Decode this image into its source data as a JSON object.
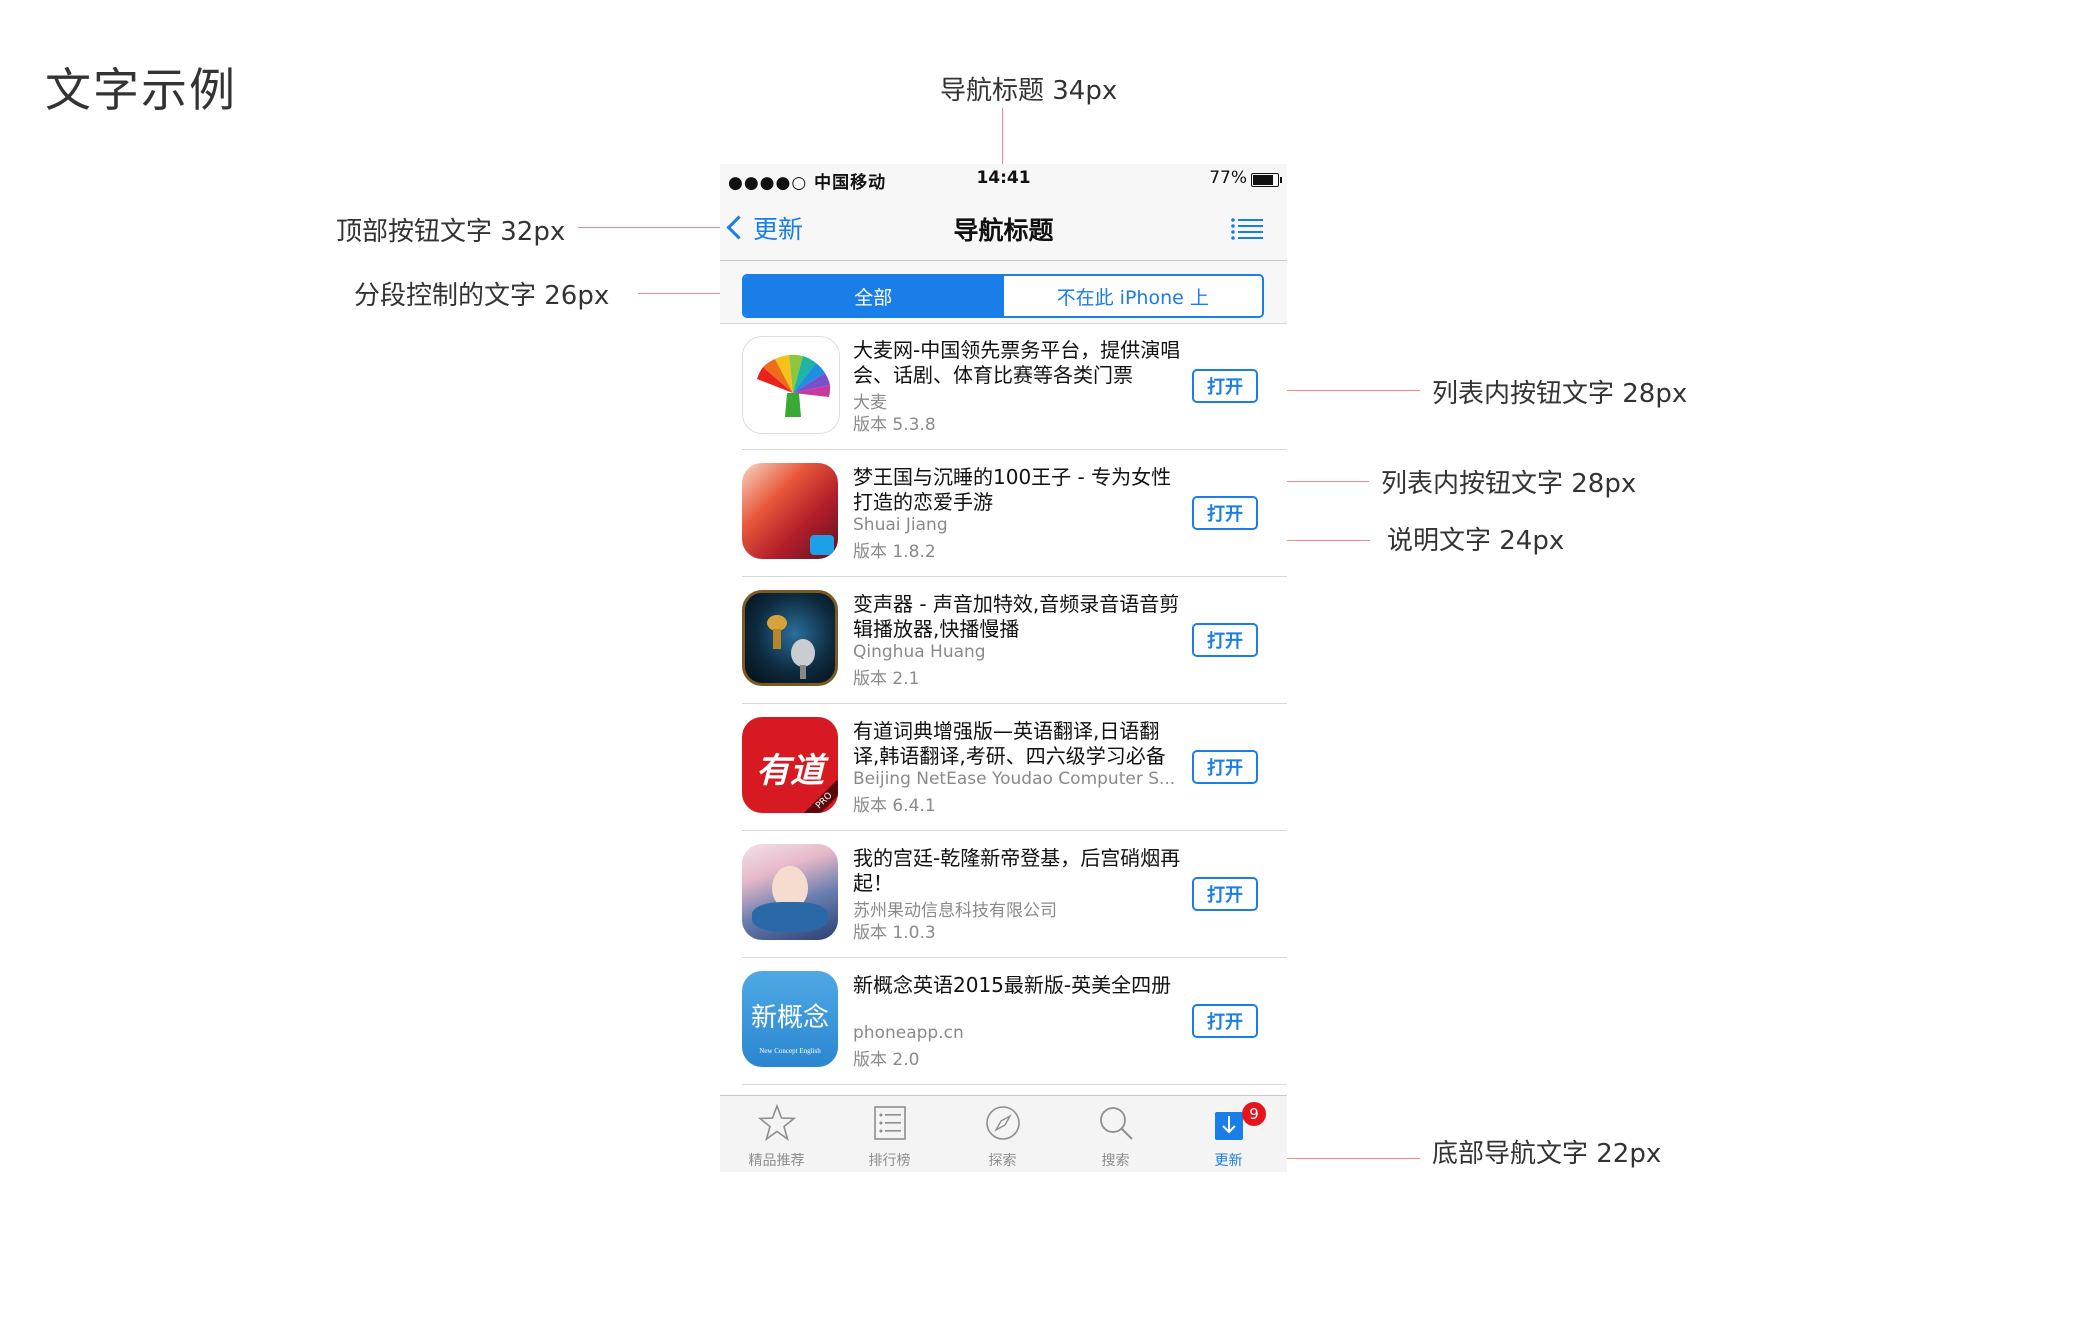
{
  "page_title": "文字示例",
  "annotations": {
    "nav_title": "导航标题 34px",
    "top_button": "顶部按钮文字 32px",
    "segment": "分段控制的文字 26px",
    "list_button_1": "列表内按钮文字 28px",
    "list_button_2": "列表内按钮文字 28px",
    "caption": "说明文字 24px",
    "tabbar": "底部导航文字 22px"
  },
  "statusbar": {
    "carrier": "●●●●○ 中国移动",
    "time": "14:41",
    "battery": "77%"
  },
  "navbar": {
    "back_label": "更新",
    "title": "导航标题"
  },
  "segment": {
    "all": "全部",
    "not_on_device": "不在此 iPhone 上"
  },
  "apps": [
    {
      "name": "大麦网-中国领先票务平台，提供演唱会、话剧、体育比赛等各类门票",
      "developer": "大麦",
      "version": "版本 5.3.8",
      "button": "打开"
    },
    {
      "name": "梦王国与沉睡的100王子 - 专为女性打造的恋爱手游",
      "developer": "Shuai Jiang",
      "version": "版本 1.8.2",
      "button": "打开"
    },
    {
      "name": "变声器 - 声音加特效,音频录音语音剪辑播放器,快播慢播",
      "developer": "Qinghua Huang",
      "version": "版本 2.1",
      "button": "打开"
    },
    {
      "name": "有道词典增强版—英语翻译,日语翻译,韩语翻译,考研、四六级学习必备",
      "developer": "Beijing NetEase Youdao Computer S...",
      "version": "版本 6.4.1",
      "button": "打开"
    },
    {
      "name": "我的宫廷-乾隆新帝登基，后宫硝烟再起！",
      "developer": "苏州果动信息科技有限公司",
      "version": "版本 1.0.3",
      "button": "打开"
    },
    {
      "name": "新概念英语2015最新版-英美全四册",
      "developer": "phoneapp.cn",
      "version": "版本 2.0",
      "button": "打开"
    }
  ],
  "icon_text": {
    "youdao": "有道",
    "youdao_pro": "PRO",
    "nce": "新概念",
    "nce_sub": "New Concept English"
  },
  "tabbar": {
    "tabs": [
      {
        "label": "精品推荐",
        "icon": "star-icon"
      },
      {
        "label": "排行榜",
        "icon": "list-icon"
      },
      {
        "label": "探索",
        "icon": "compass-icon"
      },
      {
        "label": "搜索",
        "icon": "search-icon"
      },
      {
        "label": "更新",
        "icon": "download-icon"
      }
    ],
    "badge": "9"
  },
  "colors": {
    "accent": "#1a7ee8",
    "annotation_dot": "#e8141b",
    "annotation_line": "#f28a8a",
    "badge": "#e8141b"
  }
}
